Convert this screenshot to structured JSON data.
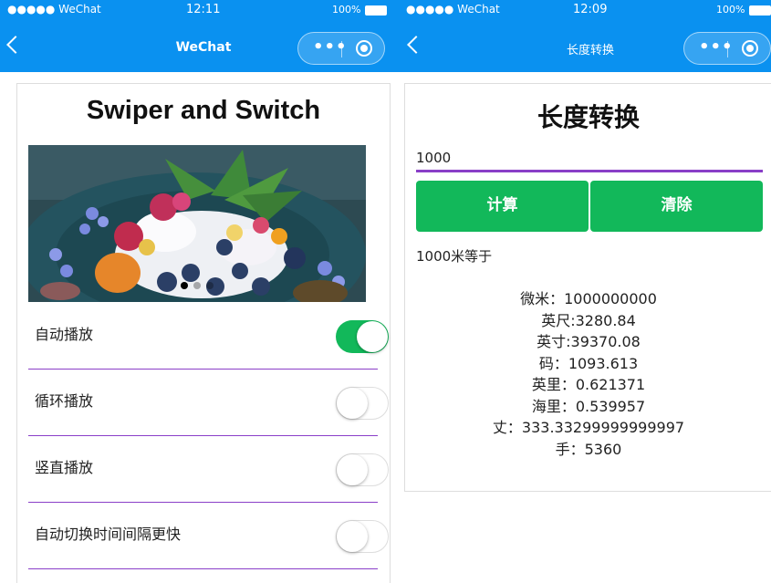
{
  "left": {
    "status": {
      "carrier": "●●●●● WeChat",
      "time": "12:11",
      "battery": "100%"
    },
    "nav": {
      "title": "WeChat"
    },
    "page_title": "Swiper and Switch",
    "swiper": {
      "dot_count": 3,
      "active_index": 0
    },
    "settings": [
      {
        "label": "自动播放",
        "on": true
      },
      {
        "label": "循环播放",
        "on": false
      },
      {
        "label": "竖直播放",
        "on": false
      },
      {
        "label": "自动切换时间间隔更快",
        "on": false
      }
    ]
  },
  "right": {
    "status": {
      "carrier": "●●●●● WeChat",
      "time": "12:09",
      "battery": "100%"
    },
    "nav": {
      "title": "长度转换"
    },
    "page_title": "长度转换",
    "input_value": "1000",
    "buttons": {
      "calculate": "计算",
      "clear": "清除"
    },
    "result_header": "1000米等于",
    "results": [
      "微米：1000000000",
      "英尺:3280.84",
      "英寸:39370.08",
      "码：1093.613",
      "英里：0.621371",
      "海里：0.539957",
      "丈：333.33299999999997",
      "手：5360"
    ]
  },
  "colors": {
    "nav_bar": "#0a91f0",
    "switch_on": "#12b85a",
    "button": "#12b85a",
    "underline": "#8a3fc8"
  }
}
